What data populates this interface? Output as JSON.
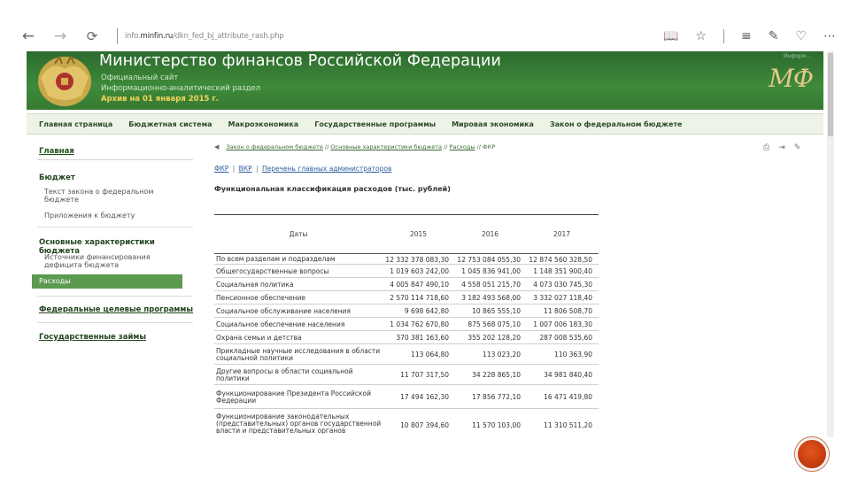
{
  "browser": {
    "url_prefix": "info.",
    "url_domain": "minfin.ru",
    "url_path": "/dkn_fed_bj_attribute_rash.php"
  },
  "header": {
    "title": "Министерство финансов Российской Федерации",
    "sub1": "Официальный сайт",
    "sub2": "Информационно-аналитический раздел",
    "archive": "Архив на 01 января 2015 г.",
    "logo_cap": "Информ...",
    "logo_text": "МФ"
  },
  "top_nav": [
    "Главная страница",
    "Бюджетная система",
    "Макроэкономика",
    "Государственные программы",
    "Мировая экономика",
    "Закон о федеральном бюджете"
  ],
  "sidebar": {
    "home": "Главная",
    "budget_heading": "Бюджет",
    "budget_items": [
      "Текст закона о федеральном бюджете",
      "Приложения к бюджету"
    ],
    "characteristics_heading": "Основные характеристики бюджета",
    "char_items": [
      "Источники финансирования дефицита бюджета"
    ],
    "active_item": "Расходы",
    "link_programs": "Федеральные целевые программы",
    "link_loans": "Государственные займы"
  },
  "breadcrumb": {
    "items": [
      "Закон о федеральном бюджете",
      "Основные характеристики бюджета",
      "Расходы",
      "ФКР"
    ],
    "separator": "//"
  },
  "content": {
    "tabs": [
      "ФКР",
      "ВКР",
      "Перечень главных администраторов"
    ],
    "tab_sep": "|",
    "title": "Функциональная классификация расходов (тыс. рублей)",
    "table": {
      "headers": [
        "Даты",
        "2015",
        "2016",
        "2017"
      ],
      "rows": [
        [
          "По всем разделам и подразделам",
          "12 332 378 083,30",
          "12 753 084 055,30",
          "12 874 560 328,50"
        ],
        [
          "Общегосударственные вопросы",
          "1 019 603 242,00",
          "1 045 836 941,00",
          "1 148 351 900,40"
        ],
        [
          "Социальная политика",
          "4 005 847 490,10",
          "4 558 051 215,70",
          "4 073 030 745,30"
        ],
        [
          "Пенсионное обеспечение",
          "2 570 114 718,60",
          "3 182 493 568,00",
          "3 332 027 118,40"
        ],
        [
          "Социальное обслуживание населения",
          "9 698 642,80",
          "10 865 555,10",
          "11 806 508,70"
        ],
        [
          "Социальное обеспечение населения",
          "1 034 762 670,80",
          "875 568 075,10",
          "1 007 006 183,30"
        ],
        [
          "Охрана семьи и детства",
          "370 381 163,60",
          "355 202 128,20",
          "287 008 535,60"
        ],
        [
          "Прикладные научные исследования в области социальной политики",
          "113 064,80",
          "113 023,20",
          "110 363,90"
        ],
        [
          "Другие вопросы в области социальной политики",
          "11 707 317,50",
          "34 228 865,10",
          "34 981 840,40"
        ],
        [
          "Функционирование Президента Российской Федерации",
          "17 494 162,30",
          "17 856 772,10",
          "16 471 419,80"
        ],
        [
          "Функционирование законодательных (представительных) органов государственной власти и представительных органов",
          "10 807 394,60",
          "11 570 103,00",
          "11 310 511,20"
        ]
      ]
    }
  },
  "colors": {
    "header_green": "#3e8a3a",
    "nav_bg": "#eef3e8",
    "active_green": "#5b9a4f",
    "archive_yellow": "#f3d35a",
    "badge_orange": "#c63c10"
  }
}
